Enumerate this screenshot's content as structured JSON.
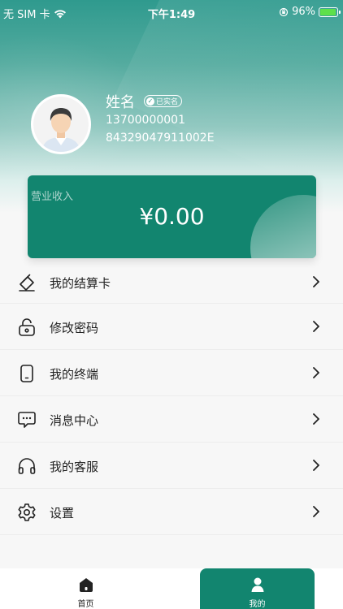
{
  "status_bar": {
    "carrier": "无 SIM 卡",
    "time": "下午1:49",
    "battery_percent": "96%",
    "battery_level": 0.96
  },
  "profile": {
    "name": "姓名",
    "verified_badge": "已实名",
    "phone": "13700000001",
    "id_number": "84329047911002E"
  },
  "income": {
    "label": "营业收入",
    "amount": "¥0.00"
  },
  "menu": {
    "items": [
      {
        "label": "我的结算卡",
        "icon": "card-icon"
      },
      {
        "label": "修改密码",
        "icon": "lock-icon"
      },
      {
        "label": "我的终端",
        "icon": "phone-icon"
      },
      {
        "label": "消息中心",
        "icon": "message-icon"
      },
      {
        "label": "我的客服",
        "icon": "headset-icon"
      },
      {
        "label": "设置",
        "icon": "gear-icon"
      }
    ]
  },
  "tab_bar": {
    "tabs": [
      {
        "label": "首页",
        "icon": "home-icon",
        "active": false
      },
      {
        "label": "我的",
        "icon": "user-icon",
        "active": true
      }
    ]
  },
  "colors": {
    "accent": "#12856f",
    "header_top": "#2f9a8e"
  }
}
